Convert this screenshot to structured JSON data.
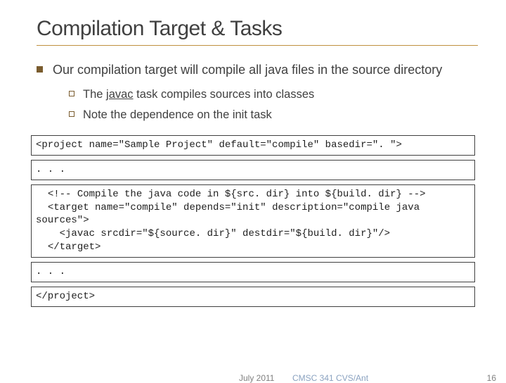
{
  "title": "Compilation Target & Tasks",
  "b1": "Our compilation target will compile all java files in the source directory",
  "b1a_pre": "The ",
  "b1a_link": "javac",
  "b1a_post": " task compiles sources into classes",
  "b1b": "Note the dependence on the init task",
  "code": {
    "l1": "<project name=\"Sample Project\" default=\"compile\" basedir=\". \">",
    "l2": ". . .",
    "l3": "  <!-- Compile the java code in ${src. dir} into ${build. dir} -->\n  <target name=\"compile\" depends=\"init\" description=\"compile java sources\">\n    <javac srcdir=\"${source. dir}\" destdir=\"${build. dir}\"/>\n  </target>",
    "l4": ". . .",
    "l5": "</project>"
  },
  "footer": {
    "date": "July 2011",
    "course": "CMSC 341 CVS/Ant",
    "page": "16"
  }
}
